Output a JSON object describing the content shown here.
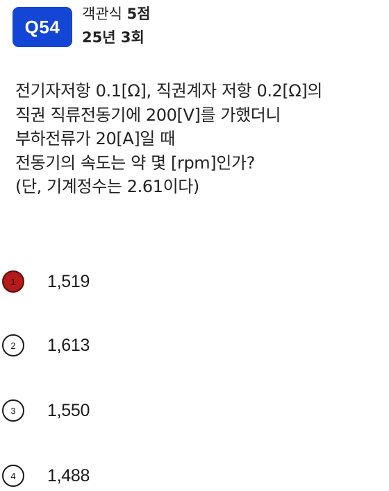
{
  "header": {
    "badge": "Q54",
    "type_label": "객관식",
    "points": "5점",
    "exam": "25년 3회"
  },
  "question": {
    "lines": [
      "전기자저항 0.1[Ω], 직권계자 저항 0.2[Ω]의",
      "직권 직류전동기에 200[V]를 가했더니",
      "부하전류가 20[A]일 때",
      "전동기의 속도는 약 몇 [rpm]인가?",
      "(단, 기계정수는 2.61이다)"
    ]
  },
  "options": [
    {
      "number": "1",
      "text": "1,519",
      "selected": true
    },
    {
      "number": "2",
      "text": "1,613",
      "selected": false
    },
    {
      "number": "3",
      "text": "1,550",
      "selected": false
    },
    {
      "number": "4",
      "text": "1,488",
      "selected": false
    }
  ],
  "colors": {
    "badge": "#1346d4",
    "selected_option": "#b51a1a"
  }
}
